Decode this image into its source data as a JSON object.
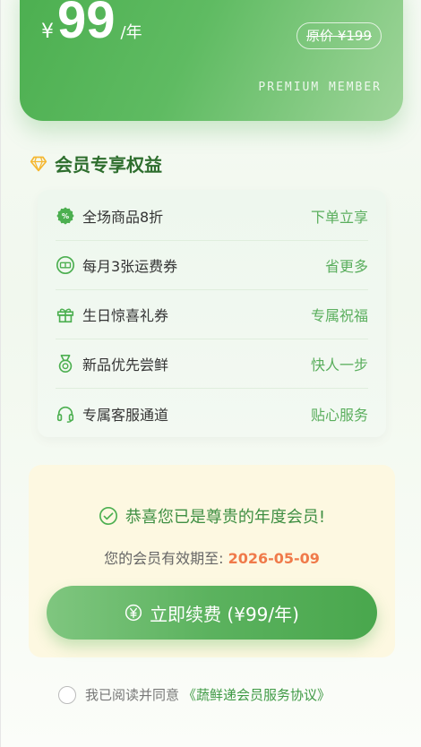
{
  "hero": {
    "currency": "¥",
    "price": "99",
    "unit": "/年",
    "original_price": "原价 ¥199",
    "badge": "PREMIUM MEMBER"
  },
  "benefits": {
    "title": "会员专享权益",
    "items": [
      {
        "icon": "discount-icon",
        "label": "全场商品8折",
        "action": "下单立享"
      },
      {
        "icon": "coupon-icon",
        "label": "每月3张运费券",
        "action": "省更多"
      },
      {
        "icon": "gift-icon",
        "label": "生日惊喜礼券",
        "action": "专属祝福"
      },
      {
        "icon": "medal-icon",
        "label": "新品优先尝鲜",
        "action": "快人一步"
      },
      {
        "icon": "headset-icon",
        "label": "专属客服通道",
        "action": "贴心服务"
      }
    ]
  },
  "status": {
    "congrats": "恭喜您已是尊贵的年度会员!",
    "expire_label": "您的会员有效期至: ",
    "expire_date": "2026-05-09",
    "renew_label": "立即续费 (¥99/年)"
  },
  "agreement": {
    "text": "我已阅读并同意",
    "link": "《蔬鲜递会员服务协议》"
  },
  "colors": {
    "primary_green": "#4caf50",
    "accent_orange": "#f07a4a",
    "status_bg": "#fdf8e1"
  }
}
